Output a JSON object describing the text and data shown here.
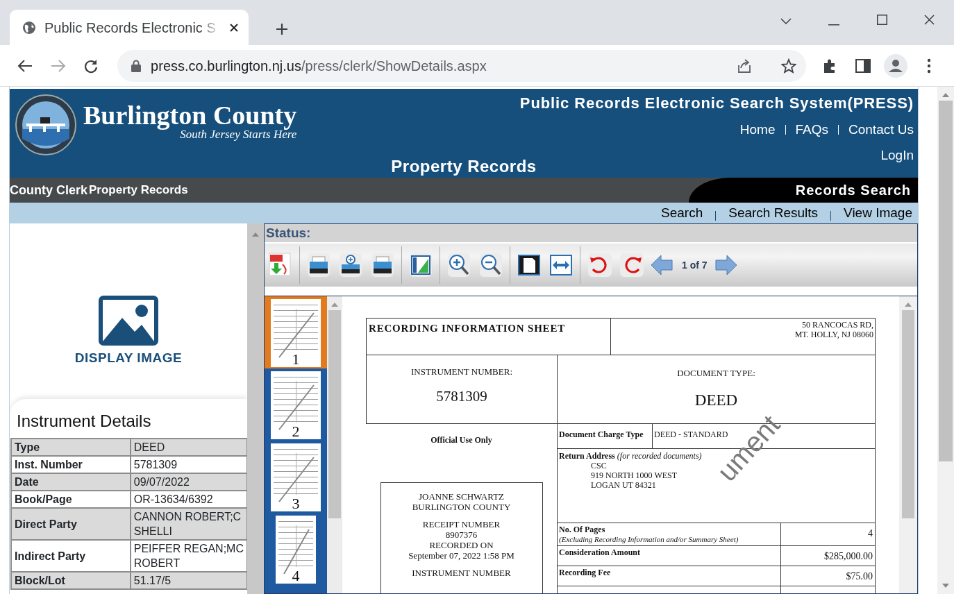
{
  "browser": {
    "tab_title": "Public Records Electronic S",
    "url_host": "press.co.burlington.nj.us",
    "url_path": "/press/clerk/ShowDetails.aspx"
  },
  "header": {
    "logo_title": "Burlington County",
    "logo_tagline": "South Jersey Starts Here",
    "system_title": "Public Records Electronic Search System(PRESS)",
    "links": [
      "Home",
      "FAQs",
      "Contact Us"
    ],
    "login": "LogIn",
    "page_title": "Property Records"
  },
  "breadcrumb": {
    "items": [
      "County Clerk",
      "Property Records"
    ],
    "section": "Records Search"
  },
  "subnav": [
    "Search",
    "Search Results",
    "View Image"
  ],
  "left_panel": {
    "display_image": "DISPLAY IMAGE",
    "details_title": "Instrument Details",
    "rows": [
      {
        "label": "Type",
        "value": [
          "DEED"
        ]
      },
      {
        "label": "Inst. Number",
        "value": [
          "5781309"
        ]
      },
      {
        "label": "Date",
        "value": [
          "09/07/2022"
        ]
      },
      {
        "label": "Book/Page",
        "value": [
          "OR-13634/6392"
        ]
      },
      {
        "label": "Direct Party",
        "value": [
          "CANNON ROBERT;C",
          "SHELLI"
        ]
      },
      {
        "label": "Indirect Party",
        "value": [
          "PEIFFER REGAN;MC",
          "ROBERT"
        ]
      },
      {
        "label": "Block/Lot",
        "value": [
          "51.17/5"
        ]
      }
    ]
  },
  "viewer": {
    "status_label": "Status:",
    "page_indicator": "1 of 7",
    "thumbnails": [
      {
        "label": "1",
        "selected": true
      },
      {
        "label": "2",
        "selected": false
      },
      {
        "label": "3",
        "selected": false
      },
      {
        "label": "4",
        "selected": false
      }
    ],
    "document": {
      "sheet_title": "RECORDING INFORMATION SHEET",
      "office_address": [
        "50 RANCOCAS RD,",
        "MT. HOLLY, NJ 08060"
      ],
      "instrument_label": "INSTRUMENT NUMBER:",
      "instrument_number": "5781309",
      "doc_type_label": "DOCUMENT TYPE:",
      "doc_type": "DEED",
      "official_use": "Official Use Only",
      "clerk_stamp": [
        [
          "JOANNE SCHWARTZ",
          "BURLINGTON COUNTY"
        ],
        [
          "RECEIPT NUMBER",
          "8907376",
          "RECORDED ON",
          "September 07, 2022 1:58 PM"
        ],
        [
          "INSTRUMENT NUMBER"
        ]
      ],
      "charge_type_label": "Document Charge Type",
      "charge_type": "DEED - STANDARD",
      "return_label": "Return Address",
      "return_note": "(for recorded documents)",
      "return_address": [
        "CSC",
        "919 NORTH 1000 WEST",
        "LOGAN UT 84321"
      ],
      "fees": [
        {
          "label": "No. Of Pages",
          "note": "(Excluding Recording Information and/or Summary Sheet)",
          "value": "4"
        },
        {
          "label": "Consideration Amount",
          "value": "$285,000.00"
        },
        {
          "label": "Recording Fee",
          "value": "$75.00"
        }
      ],
      "watermark": "ument"
    }
  }
}
